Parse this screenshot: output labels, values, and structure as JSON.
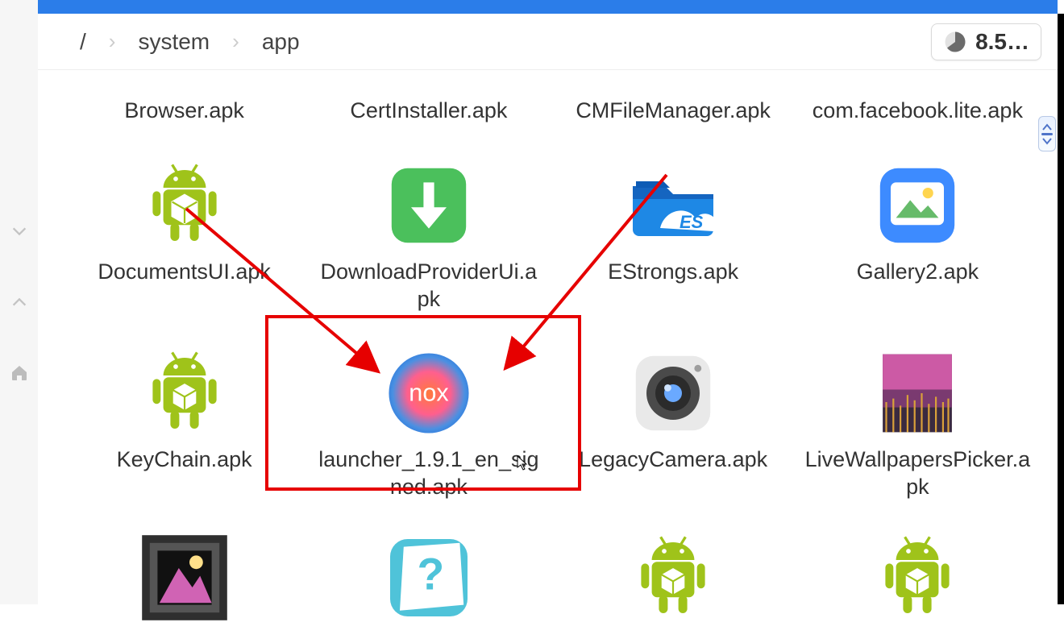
{
  "breadcrumb": {
    "root": "/",
    "segments": [
      "system",
      "app"
    ]
  },
  "storage": {
    "label": "8.5…"
  },
  "items": [
    {
      "name": "Browser.apk",
      "icon": "browser-partial"
    },
    {
      "name": "CertInstaller.apk",
      "icon": "cert-partial"
    },
    {
      "name": "CMFileManager.apk",
      "icon": "cmfile-partial"
    },
    {
      "name": "com.facebook.lite.apk",
      "icon": "fblite-partial"
    },
    {
      "name": "DocumentsUI.apk",
      "icon": "android-apk"
    },
    {
      "name": "DownloadProviderUi.apk",
      "icon": "download-green"
    },
    {
      "name": "EStrongs.apk",
      "icon": "es-folder"
    },
    {
      "name": "Gallery2.apk",
      "icon": "gallery-blue"
    },
    {
      "name": "KeyChain.apk",
      "icon": "android-apk"
    },
    {
      "name": "launcher_1.9.1_en_signed.apk",
      "icon": "nox-circle"
    },
    {
      "name": "LegacyCamera.apk",
      "icon": "camera-gray"
    },
    {
      "name": "LiveWallpapersPicker.apk",
      "icon": "livewall"
    },
    {
      "name": "",
      "icon": "picframe-partial"
    },
    {
      "name": "",
      "icon": "question-partial"
    },
    {
      "name": "",
      "icon": "android-apk-partial"
    },
    {
      "name": "",
      "icon": "android-apk-partial"
    }
  ],
  "icons": {
    "chevron": "›",
    "home": "⌂"
  }
}
